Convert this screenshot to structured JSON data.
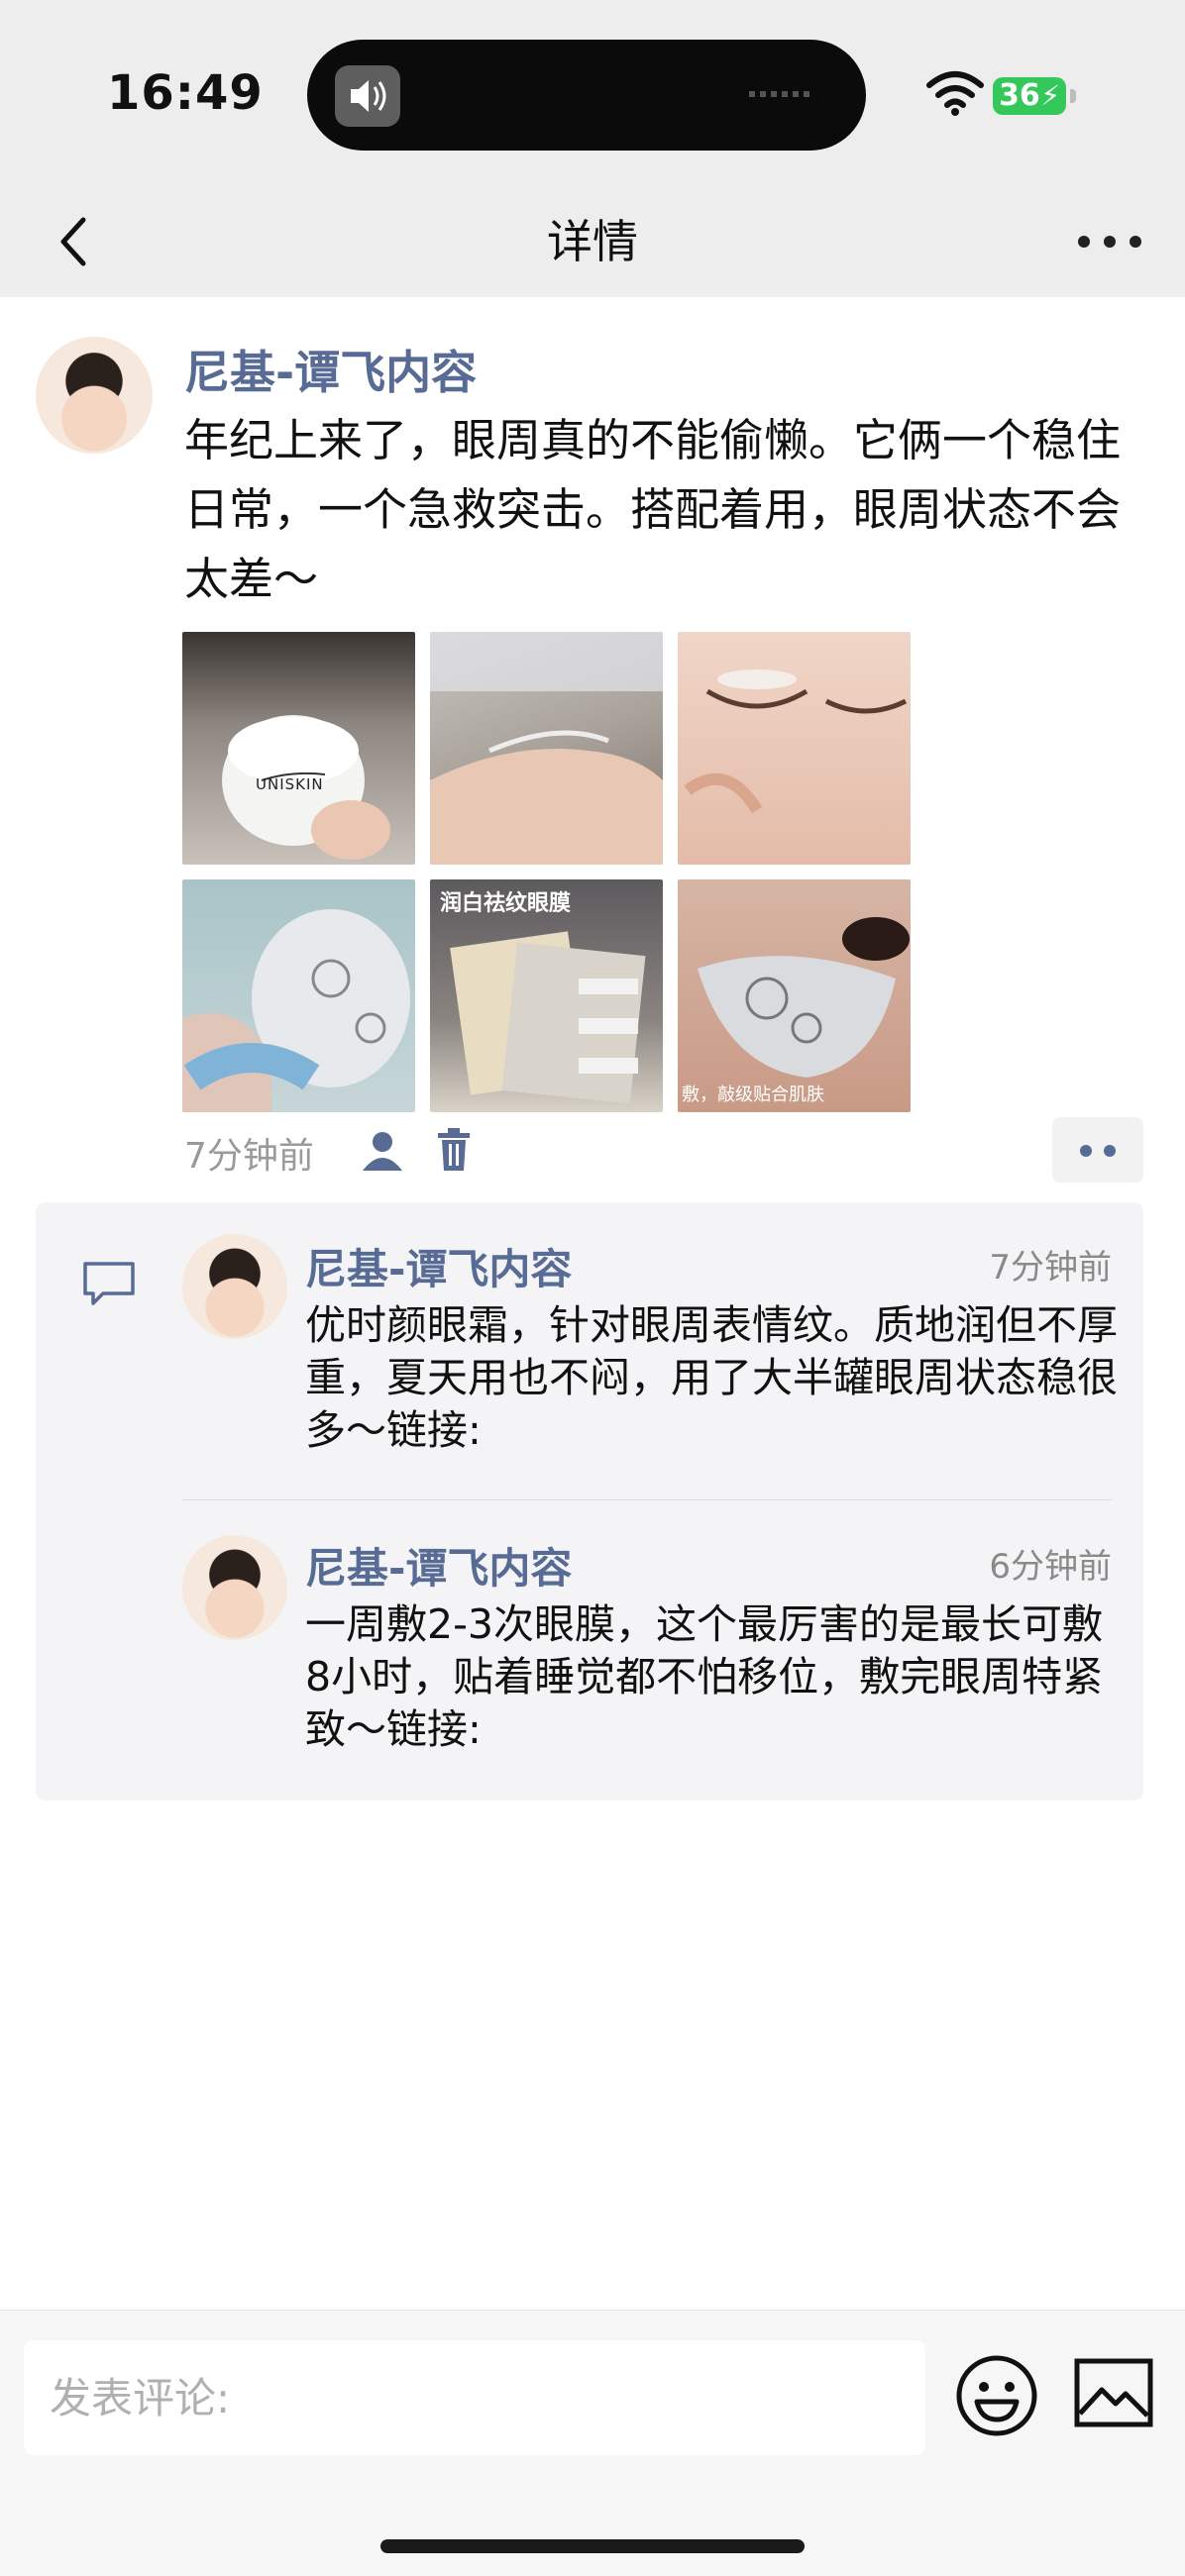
{
  "status_bar": {
    "time": "16:49",
    "battery": "36"
  },
  "nav": {
    "title": "详情"
  },
  "post": {
    "author": "尼基-谭飞内容",
    "text": "年纪上来了，眼周真的不能偷懒。它俩一个稳住日常，一个急救突击。搭配着用，眼周状态不会太差～",
    "photos": [
      {
        "caption": "UNISKIN"
      },
      {
        "caption": ""
      },
      {
        "caption": ""
      },
      {
        "caption": ""
      },
      {
        "caption": "润白祛纹眼膜"
      },
      {
        "caption": "敷，敲级贴合肌肤"
      }
    ],
    "time": "7分钟前"
  },
  "comments": [
    {
      "author": "尼基-谭飞内容",
      "time": "7分钟前",
      "text": "优时颜眼霜，针对眼周表情纹。质地润但不厚重，夏天用也不闷，用了大半罐眼周状态稳很多～链接:"
    },
    {
      "author": "尼基-谭飞内容",
      "time": "6分钟前",
      "text": "一周敷2-3次眼膜，这个最厉害的是最长可敷8小时，贴着睡觉都不怕移位，敷完眼周特紧致～链接:"
    }
  ],
  "composer": {
    "placeholder": "发表评论:"
  },
  "colors": {
    "link_name": "#576b95",
    "battery": "#34c759",
    "nav_bg": "#ededed"
  }
}
